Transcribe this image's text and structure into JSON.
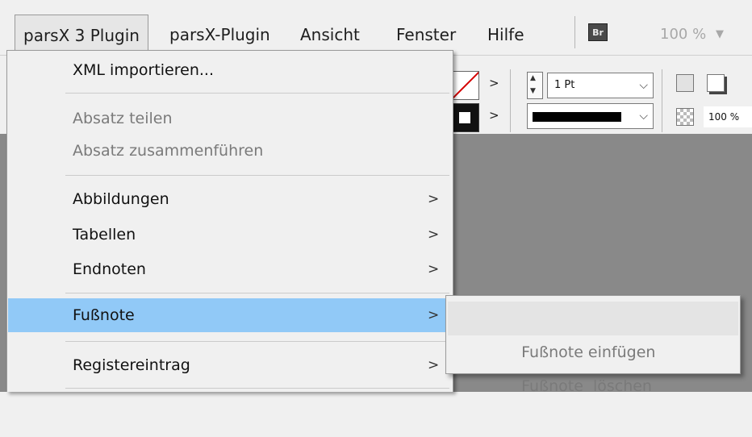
{
  "menubar": {
    "items": [
      {
        "label": "parsX 3 Plugin"
      },
      {
        "label": "parsX-Plugin"
      },
      {
        "label": "Ansicht"
      },
      {
        "label": "Fenster"
      },
      {
        "label": "Hilfe"
      }
    ],
    "bridge_badge": "Br",
    "zoom": "100 %",
    "zoom_caret": "▼"
  },
  "toolbar": {
    "stroke_weight": "1 Pt",
    "opacity": "100 %",
    "arrow": ">",
    "chevron": "⌵"
  },
  "main_menu": {
    "items": [
      {
        "label": "XML importieren...",
        "enabled": true
      },
      {
        "label": "Absatz teilen",
        "enabled": false
      },
      {
        "label": "Absatz zusammenführen",
        "enabled": false
      },
      {
        "label": "Abbildungen",
        "enabled": true,
        "submenu": true
      },
      {
        "label": "Tabellen",
        "enabled": true,
        "submenu": true
      },
      {
        "label": "Endnoten",
        "enabled": true,
        "submenu": true
      },
      {
        "label": "Fußnote",
        "enabled": true,
        "submenu": true,
        "highlighted": true
      },
      {
        "label": "Registereintrag",
        "enabled": true,
        "submenu": true
      }
    ],
    "submenu_arrow": ">"
  },
  "sub_menu": {
    "items": [
      {
        "label": "Fußnote einfügen",
        "enabled": false
      },
      {
        "label": "Fußnote  löschen",
        "enabled": false
      }
    ]
  },
  "colors": {
    "highlight": "#91c9f7",
    "canvas": "#898989",
    "menu_bg": "#f0f0f0",
    "disabled_text": "#7a7a7a"
  }
}
